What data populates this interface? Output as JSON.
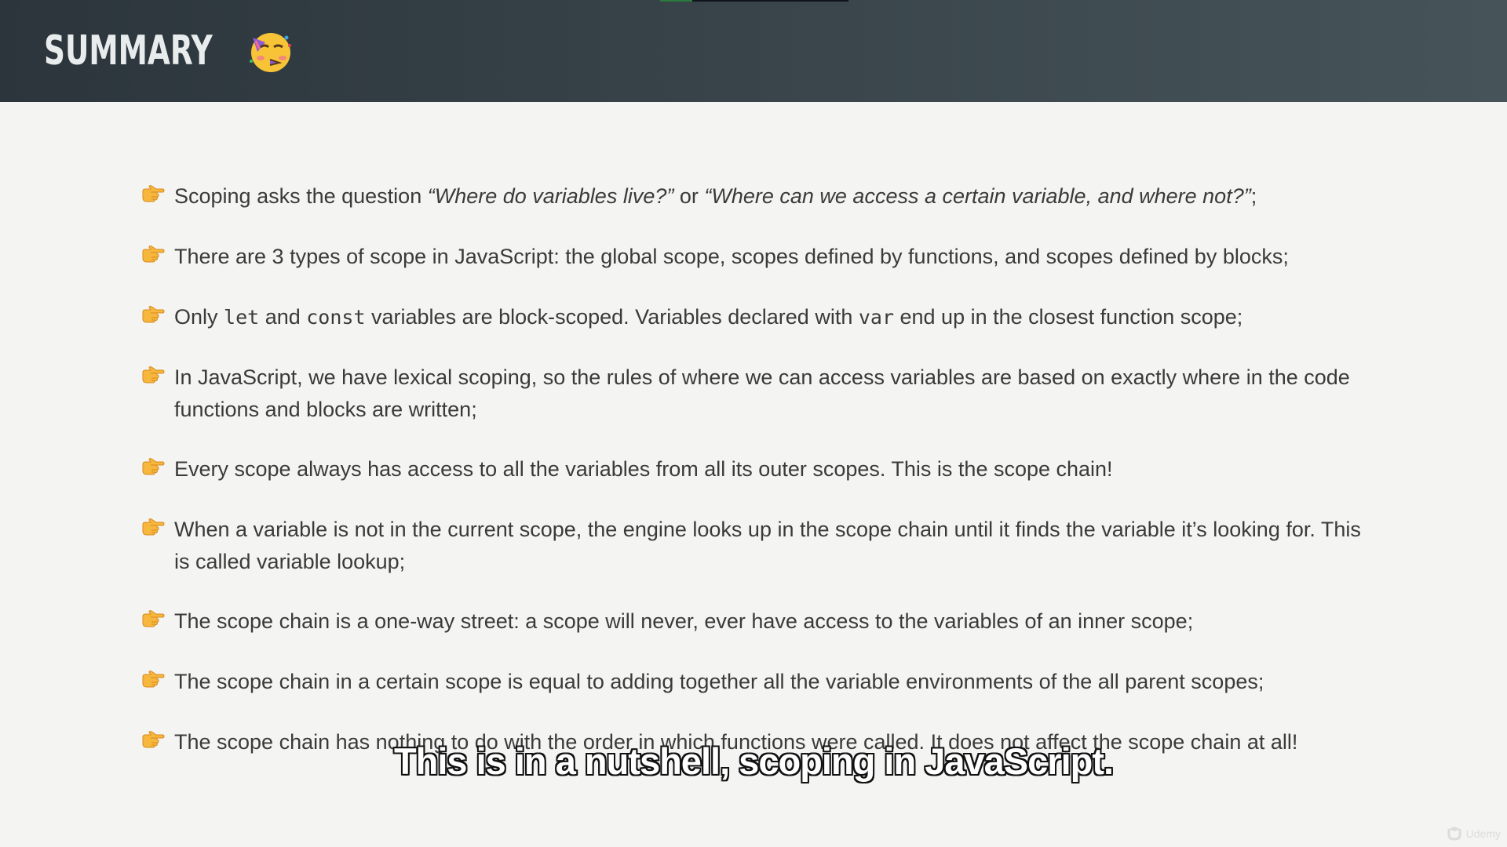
{
  "header": {
    "title": "SUMMARY",
    "emoji_icon": "partying-face-icon",
    "video_progress_fraction": 0.17,
    "accent": "#2a7a3c"
  },
  "bullet_icon": "pointing-hand-icon",
  "bullets": [
    {
      "p0": "Scoping asks the question ",
      "q1": "“Where do variables live?”",
      "p1": " or ",
      "q2": "“Where can we access a certain variable, and where not?”",
      "p2": ";"
    },
    {
      "text": "There are 3 types of scope in JavaScript: the global scope, scopes defined by functions, and scopes defined by blocks;"
    },
    {
      "p0": "Only ",
      "c1": "let",
      "p1": " and ",
      "c2": "const",
      "p2": " variables are block-scoped. Variables declared with ",
      "c3": "var",
      "p3": " end up in the closest function scope;"
    },
    {
      "text": "In JavaScript, we have lexical scoping, so the rules of where we can access variables are based on exactly where in the code functions and blocks are written;"
    },
    {
      "text": "Every scope always has access to all the variables from all its outer scopes. This is the scope chain!"
    },
    {
      "text": "When a variable is not in the current scope, the engine looks up in the scope chain until it finds the variable it’s looking for. This is called variable lookup;"
    },
    {
      "text": "The scope chain is a one-way street: a scope will never, ever have access to the variables of an inner scope;"
    },
    {
      "text": "The scope chain in a certain scope is equal to adding together all the variable environments of the all parent scopes;"
    },
    {
      "text": "The scope chain has nothing to do with the order in which functions were called. It does not affect the scope chain at all!"
    }
  ],
  "subtitle": "This is in a nutshell, scoping in JavaScript.",
  "watermark": "Udemy"
}
